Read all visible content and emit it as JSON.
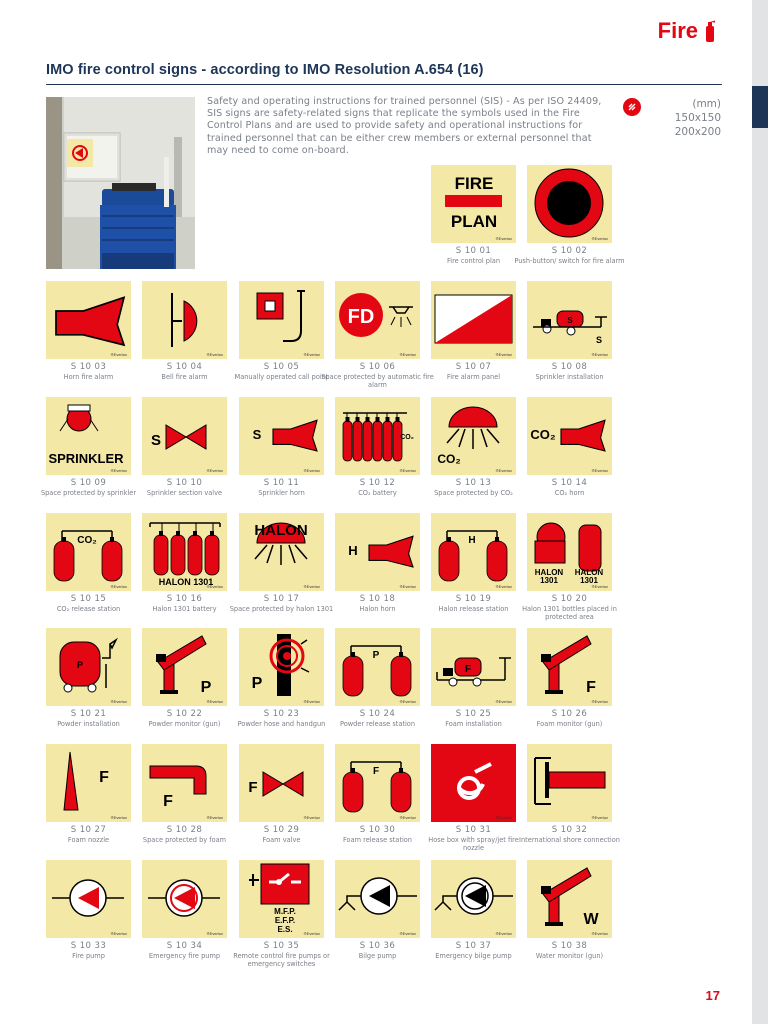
{
  "header": {
    "section": "Fire"
  },
  "title": "IMO fire control signs - according to IMO Resolution A.654 (16)",
  "intro": "Safety and operating instructions for trained personnel (SIS) - As per ISO 24409, SIS signs are safety-related signs that replicate the symbols used in the Fire Control Plans and are used to provide safety and operational instructions for trained personnel that can be either crew members or external personnel that may need to come on-board.",
  "sizes": {
    "unit": "(mm)",
    "options": [
      "150x150",
      "200x200"
    ]
  },
  "brand_mark": "®Everlux",
  "photo": {
    "alt": ""
  },
  "signs": [
    {
      "code": "S 10 01",
      "caption": "Fire control plan",
      "icon": "fire-plan",
      "texts": [
        "FIRE",
        "PLAN"
      ]
    },
    {
      "code": "S 10 02",
      "caption": "Push-button/ switch for fire alarm",
      "icon": "push-button"
    },
    {
      "code": "S 10 03",
      "caption": "Horn fire alarm",
      "icon": "horn"
    },
    {
      "code": "S 10 04",
      "caption": "Bell fire alarm",
      "icon": "bell"
    },
    {
      "code": "S 10 05",
      "caption": "Manually operated call point",
      "icon": "call-point"
    },
    {
      "code": "S 10 06",
      "caption": "Space protected by automatic fire alarm",
      "icon": "fire-detector",
      "texts": [
        "FD"
      ]
    },
    {
      "code": "S 10 07",
      "caption": "Fire alarm panel",
      "icon": "alarm-panel"
    },
    {
      "code": "S 10 08",
      "caption": "Sprinkler installation",
      "icon": "sprinkler-installation",
      "texts": [
        "S",
        "S"
      ]
    },
    {
      "code": "S 10 09",
      "caption": "Space protected by sprinkler",
      "icon": "sprinkler-head",
      "texts": [
        "SPRINKLER"
      ]
    },
    {
      "code": "S 10 10",
      "caption": "Sprinkler section valve",
      "icon": "valve",
      "texts": [
        "S"
      ]
    },
    {
      "code": "S 10 11",
      "caption": "Sprinkler horn",
      "icon": "horn-letter",
      "texts": [
        "S"
      ]
    },
    {
      "code": "S 10 12",
      "caption": "CO₂ battery",
      "icon": "co2-battery",
      "texts": [
        "CO₂"
      ]
    },
    {
      "code": "S 10 13",
      "caption": "Space protected by CO₂",
      "icon": "dome-spray",
      "texts": [
        "CO₂"
      ]
    },
    {
      "code": "S 10 14",
      "caption": "CO₂ horn",
      "icon": "horn-letter",
      "texts": [
        "CO₂"
      ]
    },
    {
      "code": "S 10 15",
      "caption": "CO₂ release station",
      "icon": "release-station",
      "texts": [
        "CO₂"
      ]
    },
    {
      "code": "S 10 16",
      "caption": "Halon 1301 battery",
      "icon": "halon-battery",
      "texts": [
        "HALON 1301"
      ]
    },
    {
      "code": "S 10 17",
      "caption": "Space protected by halon 1301",
      "icon": "dome-spray",
      "texts": [
        "HALON"
      ]
    },
    {
      "code": "S 10 18",
      "caption": "Halon horn",
      "icon": "horn-letter",
      "texts": [
        "H"
      ]
    },
    {
      "code": "S 10 19",
      "caption": "Halon release station",
      "icon": "release-station",
      "texts": [
        "H"
      ]
    },
    {
      "code": "S 10 20",
      "caption": "Halon 1301 bottles placed in protected area",
      "icon": "halon-bottles",
      "texts": [
        "HALON 1301",
        "HALON 1301"
      ]
    },
    {
      "code": "S 10 21",
      "caption": "Powder installation",
      "icon": "tank-wheels",
      "texts": [
        "P"
      ]
    },
    {
      "code": "S 10 22",
      "caption": "Powder monitor (gun)",
      "icon": "monitor",
      "texts": [
        "P"
      ]
    },
    {
      "code": "S 10 23",
      "caption": "Powder hose and handgun",
      "icon": "hose-reel",
      "texts": [
        "P"
      ]
    },
    {
      "code": "S 10 24",
      "caption": "Powder release station",
      "icon": "release-station",
      "texts": [
        "P"
      ]
    },
    {
      "code": "S 10 25",
      "caption": "Foam installation",
      "icon": "foam-installation",
      "texts": [
        "F"
      ]
    },
    {
      "code": "S 10 26",
      "caption": "Foam monitor (gun)",
      "icon": "monitor",
      "texts": [
        "F"
      ]
    },
    {
      "code": "S 10 27",
      "caption": "Foam nozzle",
      "icon": "nozzle",
      "texts": [
        "F"
      ]
    },
    {
      "code": "S 10 28",
      "caption": "Space protected by foam",
      "icon": "foam-pipe",
      "texts": [
        "F"
      ]
    },
    {
      "code": "S 10 29",
      "caption": "Foam valve",
      "icon": "valve",
      "texts": [
        "F"
      ]
    },
    {
      "code": "S 10 30",
      "caption": "Foam release station",
      "icon": "release-station",
      "texts": [
        "F"
      ]
    },
    {
      "code": "S 10 31",
      "caption": "Hose box with spray/jet fire nozzle",
      "icon": "hose-box"
    },
    {
      "code": "S 10 32",
      "caption": "International shore connection",
      "icon": "shore-connection"
    },
    {
      "code": "S 10 33",
      "caption": "Fire pump",
      "icon": "pump"
    },
    {
      "code": "S 10 34",
      "caption": "Emergency fire pump",
      "icon": "pump-emergency"
    },
    {
      "code": "S 10 35",
      "caption": "Remote control fire pumps or emergency switches",
      "icon": "remote-control",
      "texts": [
        "M.F.P.",
        "E.F.P.",
        "E.S."
      ]
    },
    {
      "code": "S 10 36",
      "caption": "Bilge pump",
      "icon": "bilge-pump"
    },
    {
      "code": "S 10 37",
      "caption": "Emergency bilge pump",
      "icon": "bilge-pump-emergency"
    },
    {
      "code": "S 10 38",
      "caption": "Water monitor (gun)",
      "icon": "monitor",
      "texts": [
        "W"
      ]
    }
  ],
  "page_number": "17",
  "colors": {
    "accent": "#e30613",
    "sign_background": "#f4e8a6",
    "title": "#1d3557",
    "body_text": "#7b8089"
  }
}
